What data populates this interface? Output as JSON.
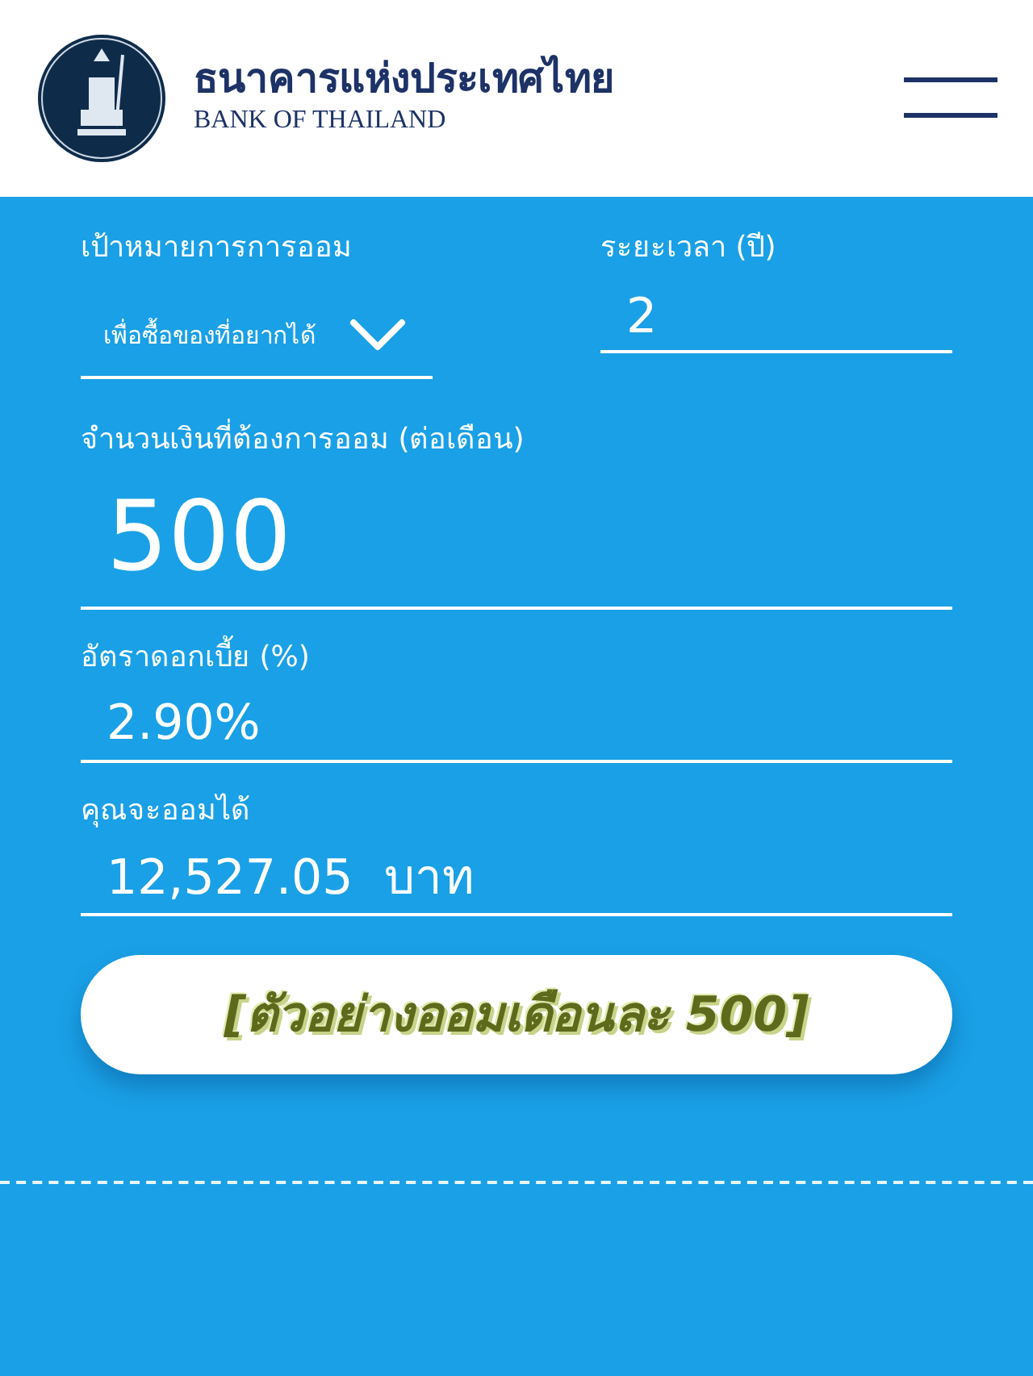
{
  "header": {
    "title_thai": "ธนาคารแห่งประเทศไทย",
    "title_english": "BANK OF THAILAND"
  },
  "form": {
    "goal": {
      "label": "เป้าหมายการการออม",
      "value": "เพื่อซื้อของที่อยากได้"
    },
    "duration": {
      "label": "ระยะเวลา (ปี)",
      "value": "2"
    },
    "fields": [
      {
        "kind": "big",
        "label": "จำนวนเงินที่ต้องการออม (ต่อเดือน)",
        "value": "500"
      },
      {
        "kind": "normal",
        "label": "อัตราดอกเบี้ย (%)",
        "value": "2.90%"
      },
      {
        "kind": "normal",
        "label": "คุณจะออมได้",
        "value": "12,527.05  บาท"
      }
    ]
  },
  "caption_button": {
    "label": "[ตัวอย่างออมเดือนละ 500]"
  }
}
